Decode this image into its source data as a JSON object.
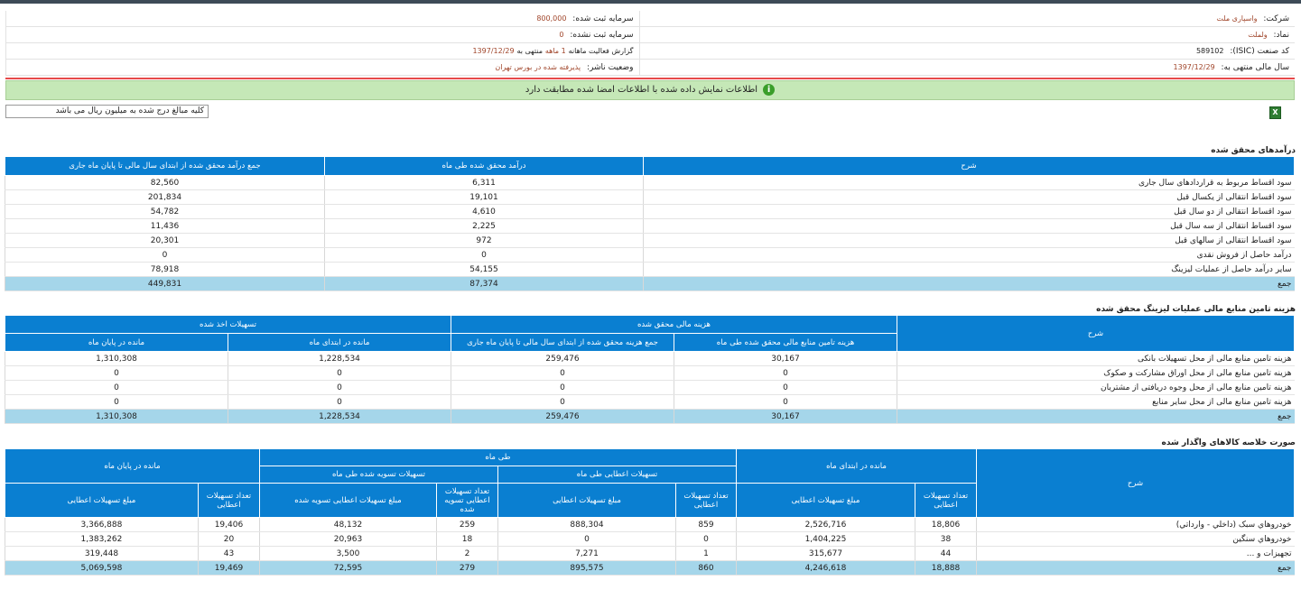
{
  "header": {
    "company_label": "شرکت:",
    "company_value": "واسپاری ملت",
    "symbol_label": "نماد:",
    "symbol_value": "ولملت",
    "isic_label": "کد صنعت (ISIC):",
    "isic_value": "589102",
    "fiscal_label": "سال مالی منتهی به:",
    "fiscal_value": "1397/12/29",
    "reg_capital_label": "سرمایه ثبت شده:",
    "reg_capital_value": "800,000",
    "unreg_capital_label": "سرمایه ثبت نشده:",
    "unreg_capital_value": "0",
    "report_text_a": "گزارش فعالیت ماهانه",
    "report_text_b": "1 ماهه",
    "report_text_c": "منتهی به",
    "report_date": "1397/12/29",
    "publisher_label": "وضعیت ناشر:",
    "publisher_value": "پذیرفته شده در بورس تهران"
  },
  "banner_text": "اطلاعات نمایش داده شده با اطلاعات امضا شده مطابقت دارد",
  "banner_icon": "info-icon",
  "units_note": "کلیه مبالغ درج شده به میلیون ریال می باشد",
  "excel_icon": "excel-icon",
  "revenue": {
    "title": "درآمدهای محقق شده",
    "headers": [
      "شرح",
      "درآمد محقق شده طی ماه",
      "جمع درآمد محقق شده از ابتدای سال مالی تا پایان ماه جاری"
    ],
    "rows": [
      [
        "سود اقساط مربوط به قراردادهای سال جاری",
        "6,311",
        "82,560"
      ],
      [
        "سود اقساط انتقالی از یکسال قبل",
        "19,101",
        "201,834"
      ],
      [
        "سود اقساط انتقالی از دو سال قبل",
        "4,610",
        "54,782"
      ],
      [
        "سود اقساط انتقالی از سه سال قبل",
        "2,225",
        "11,436"
      ],
      [
        "سود اقساط انتقالی از سالهای قبل",
        "972",
        "20,301"
      ],
      [
        "درآمد حاصل از فروش نقدی",
        "0",
        "0"
      ],
      [
        "سایر درآمد حاصل از عملیات لیزینگ",
        "54,155",
        "78,918"
      ]
    ],
    "total": [
      "جمع",
      "87,374",
      "449,831"
    ]
  },
  "finance": {
    "title": "هزینه تامین منابع مالی عملیات لیزینگ محقق شده",
    "desc_header": "شرح",
    "group1": "هزینه مالی محقق شده",
    "group2": "تسهیلات اخذ شده",
    "sub": [
      "هزینه تامین منابع مالی محقق شده طی ماه",
      "جمع هزینه محقق شده از ابتدای سال مالی تا پایان ماه جاری",
      "مانده در ابتدای ماه",
      "مانده در پایان ماه"
    ],
    "rows": [
      [
        "هزینه تامین منابع مالی از محل تسهیلات بانکی",
        "30,167",
        "259,476",
        "1,228,534",
        "1,310,308"
      ],
      [
        "هزینه تامین منابع مالی از محل اوراق مشارکت و صکوک",
        "0",
        "0",
        "0",
        "0"
      ],
      [
        "هزینه تامین منابع مالی از محل وجوه دریافتی از مشتریان",
        "0",
        "0",
        "0",
        "0"
      ],
      [
        "هزینه تامین منابع مالی از محل سایر منابع",
        "0",
        "0",
        "0",
        "0"
      ]
    ],
    "total": [
      "جمع",
      "30,167",
      "259,476",
      "1,228,534",
      "1,310,308"
    ]
  },
  "goods": {
    "title": "صورت خلاصه کالاهای واگذار شده",
    "desc_header": "شرح",
    "g_start": "مانده در ابتدای ماه",
    "g_month": "طی ماه",
    "g_end": "مانده در پایان ماه",
    "g_granted": "تسهیلات اعطایی طی ماه",
    "g_settled": "تسهیلات تسویه شده طی ماه",
    "count_granted": "تعداد تسهیلات اعطایی",
    "amount_granted": "مبلغ تسهیلات اعطایی",
    "count_settled": "تعداد تسهیلات اعطایی تسویه شده",
    "amount_settled": "مبلغ تسهیلات اعطایی تسویه شده",
    "rows": [
      [
        "خودروهاي سبک (داخلي - وارداتي)",
        "18,806",
        "2,526,716",
        "859",
        "888,304",
        "259",
        "48,132",
        "19,406",
        "3,366,888"
      ],
      [
        "خودروهاي سنگين",
        "38",
        "1,404,225",
        "0",
        "0",
        "18",
        "20,963",
        "20",
        "1,383,262"
      ],
      [
        "تجهيزات و ...",
        "44",
        "315,677",
        "1",
        "7,271",
        "2",
        "3,500",
        "43",
        "319,448"
      ]
    ],
    "total": [
      "جمع",
      "18,888",
      "4,246,618",
      "860",
      "895,575",
      "279",
      "72,595",
      "19,469",
      "5,069,598"
    ]
  }
}
